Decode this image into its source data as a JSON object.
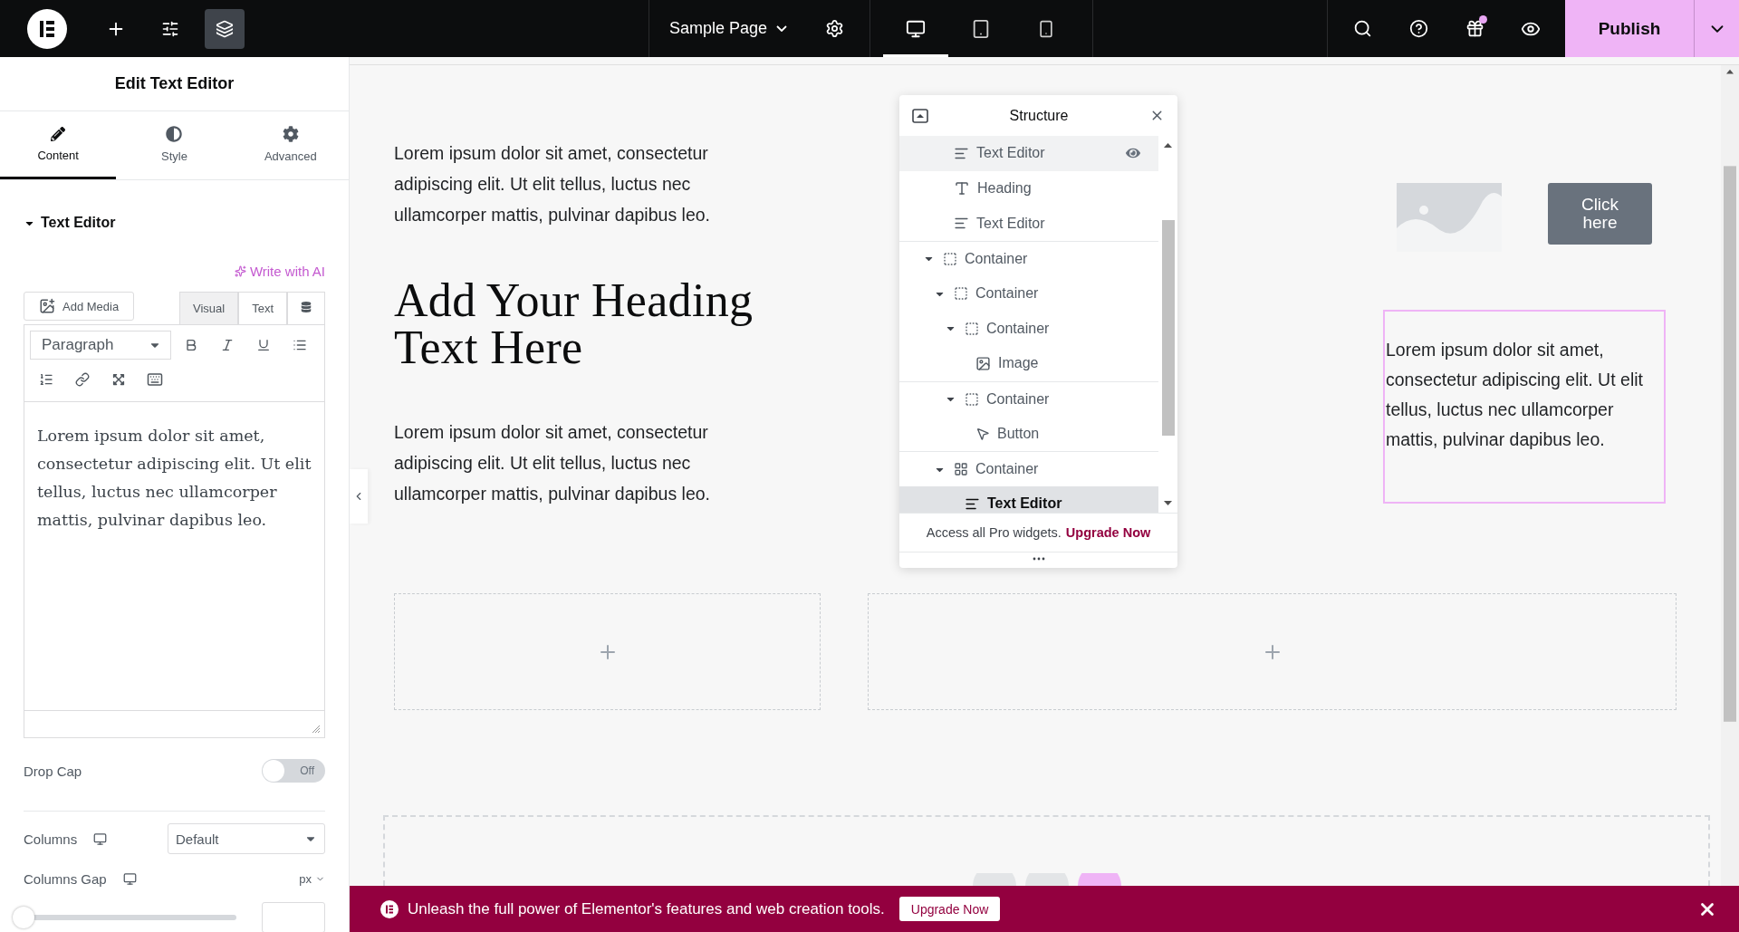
{
  "top_bar": {
    "tools": [
      {
        "kind": "add",
        "selected": false
      },
      {
        "kind": "settings",
        "selected": false
      },
      {
        "kind": "layers",
        "selected": true
      }
    ],
    "page_title": "Sample Page",
    "devices": [
      {
        "kind": "desktop",
        "selected": true
      },
      {
        "kind": "tablet",
        "selected": false
      },
      {
        "kind": "mobile",
        "selected": false
      }
    ],
    "notification": true,
    "publish": "Publish"
  },
  "panel": {
    "title": "Edit Text Editor",
    "tabs": [
      {
        "kind": "content",
        "label": "Content",
        "selected": true
      },
      {
        "kind": "style",
        "label": "Style",
        "selected": false
      },
      {
        "kind": "advanced",
        "label": "Advanced",
        "selected": false
      }
    ],
    "section": {
      "title": "Text Editor",
      "expanded": true
    },
    "write_ai": "Write with AI",
    "add_media": "Add Media",
    "modes": [
      {
        "label": "Visual",
        "selected": true
      },
      {
        "label": "Text",
        "selected": false
      }
    ],
    "format": "Paragraph",
    "editor_text": "Lorem ipsum dolor sit amet, consectetur adipiscing elit. Ut elit tellus, luctus nec ullamcorper mattis, pulvinar dapibus leo.",
    "drop_cap": {
      "label": "Drop Cap",
      "on": false,
      "state_text": "Off"
    },
    "columns": {
      "label": "Columns",
      "value": "Default"
    },
    "columns_gap": {
      "label": "Columns Gap",
      "unit": "px",
      "level": 0
    }
  },
  "canvas": {
    "text_1": "Lorem ipsum dolor sit amet, consectetur adipiscing elit. Ut elit tellus, luctus nec ullamcorper mattis, pulvinar dapibus leo.",
    "heading": "Add Your Heading Text Here",
    "text_2": "Lorem ipsum dolor sit amet, consectetur adipiscing elit. Ut elit tellus, luctus nec ullamcorper mattis, pulvinar dapibus leo.",
    "image": {
      "kind": "placeholder"
    },
    "button": "Click here",
    "selected_text": "Lorem ipsum dolor sit amet, consectetur adipiscing elit. Ut elit tellus, luctus nec ullamcorper mattis, pulvinar dapibus leo."
  },
  "structure": {
    "title": "Structure",
    "tree": [
      {
        "children": [
          {
            "kind": "text",
            "label": "Text Editor",
            "hovered": true,
            "selected": false
          },
          {
            "kind": "heading",
            "label": "Heading",
            "hovered": false,
            "selected": false
          },
          {
            "kind": "text",
            "label": "Text Editor",
            "hovered": false,
            "selected": false
          }
        ]
      },
      {
        "kind": "container",
        "label": "Container",
        "expanded": true,
        "hovered": false,
        "selected": false,
        "children": [
          {
            "kind": "container",
            "label": "Container",
            "expanded": true,
            "hovered": false,
            "selected": false,
            "children": [
              {
                "kind": "container",
                "label": "Container",
                "expanded": true,
                "hovered": false,
                "selected": false,
                "children": [
                  {
                    "kind": "image",
                    "label": "Image",
                    "hovered": false,
                    "selected": false
                  }
                ]
              },
              {
                "kind": "container",
                "label": "Container",
                "expanded": true,
                "hovered": false,
                "selected": false,
                "children": [
                  {
                    "kind": "button",
                    "label": "Button",
                    "hovered": false,
                    "selected": false
                  }
                ]
              }
            ]
          },
          {
            "kind": "grid",
            "label": "Container",
            "expanded": true,
            "hovered": false,
            "selected": false,
            "children": [
              {
                "kind": "text",
                "label": "Text Editor",
                "hovered": false,
                "selected": true
              }
            ]
          }
        ]
      }
    ],
    "promo": "Access all Pro widgets.",
    "promo_link": "Upgrade Now"
  },
  "banner": {
    "text": "Unleash the full power of Elementor's features and web creation tools.",
    "button": "Upgrade Now"
  }
}
